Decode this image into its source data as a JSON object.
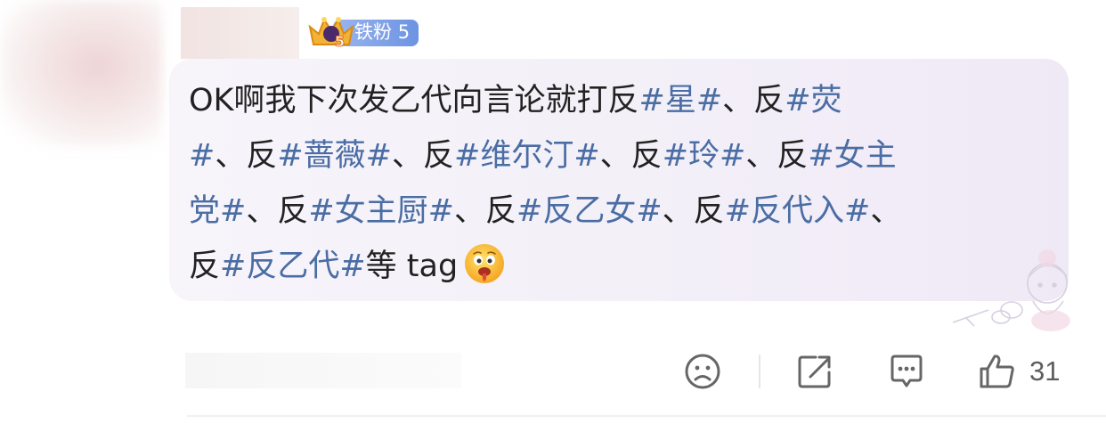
{
  "user": {
    "badge_label": "铁粉",
    "badge_level": "5",
    "crown_level": "5"
  },
  "comment": {
    "segments": [
      {
        "text": "OK啊我下次发乙代向言论就打反",
        "type": "text"
      },
      {
        "text": "#星#",
        "type": "hashtag"
      },
      {
        "text": "、反",
        "type": "text"
      },
      {
        "text": "#荧#",
        "type": "hashtag"
      },
      {
        "text": "、反",
        "type": "text"
      },
      {
        "text": "#蔷薇#",
        "type": "hashtag"
      },
      {
        "text": "、反",
        "type": "text"
      },
      {
        "text": "#维尔汀#",
        "type": "hashtag"
      },
      {
        "text": "、反",
        "type": "text"
      },
      {
        "text": "#玲#",
        "type": "hashtag"
      },
      {
        "text": "、反",
        "type": "text"
      },
      {
        "text": "#女主党#",
        "type": "hashtag"
      },
      {
        "text": "、反",
        "type": "text"
      },
      {
        "text": "#女主厨#",
        "type": "hashtag"
      },
      {
        "text": "、反",
        "type": "text"
      },
      {
        "text": "#反乙女#",
        "type": "hashtag"
      },
      {
        "text": "、反",
        "type": "text"
      },
      {
        "text": "#反代入#",
        "type": "hashtag"
      },
      {
        "text": "、反",
        "type": "text"
      },
      {
        "text": "#反乙代#",
        "type": "hashtag"
      },
      {
        "text": "等 tag",
        "type": "text"
      }
    ],
    "lines": [
      [
        {
          "text": "OK啊我下次发乙代向言论就打反",
          "hashtag": false
        },
        {
          "text": "#星#",
          "hashtag": true
        },
        {
          "text": "、反",
          "hashtag": false
        },
        {
          "text": "#荧",
          "hashtag": true
        }
      ],
      [
        {
          "text": "#",
          "hashtag": true
        },
        {
          "text": "、反",
          "hashtag": false
        },
        {
          "text": "#蔷薇#",
          "hashtag": true
        },
        {
          "text": "、反",
          "hashtag": false
        },
        {
          "text": "#维尔汀#",
          "hashtag": true
        },
        {
          "text": "、反",
          "hashtag": false
        },
        {
          "text": "#玲#",
          "hashtag": true
        },
        {
          "text": "、反",
          "hashtag": false
        },
        {
          "text": "#女主",
          "hashtag": true
        }
      ],
      [
        {
          "text": "党#",
          "hashtag": true
        },
        {
          "text": "、反",
          "hashtag": false
        },
        {
          "text": "#女主厨#",
          "hashtag": true
        },
        {
          "text": "、反",
          "hashtag": false
        },
        {
          "text": "#反乙女#",
          "hashtag": true
        },
        {
          "text": "、反",
          "hashtag": false
        },
        {
          "text": "#反代入#",
          "hashtag": true
        },
        {
          "text": "、",
          "hashtag": false
        }
      ],
      [
        {
          "text": "反",
          "hashtag": false
        },
        {
          "text": "#反乙代#",
          "hashtag": true
        },
        {
          "text": "等 tag",
          "hashtag": false
        }
      ]
    ],
    "trailing_emoji": "drooling-face-emoji"
  },
  "actions": {
    "dislike_icon": "sad-face-icon",
    "share_icon": "share-icon",
    "reply_icon": "comment-bubble-icon",
    "like_icon": "thumbs-up-icon",
    "like_count": "31"
  },
  "colors": {
    "hashtag": "#4a6da4",
    "text": "#222222",
    "bubble": "#f5f1f9",
    "badge": "#7d9fe6",
    "icon": "#666666"
  }
}
